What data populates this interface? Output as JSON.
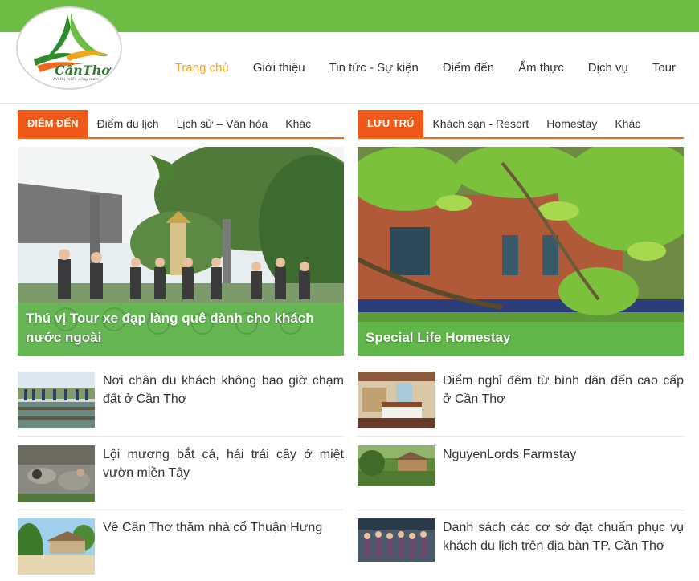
{
  "logo": {
    "text": "CầnThơ",
    "tagline": "Đô thị miền sông nước"
  },
  "nav": {
    "items": [
      "Trang chủ",
      "Giới thiệu",
      "Tin tức - Sự kiện",
      "Điểm đến",
      "Ẩm thực",
      "Dịch vụ",
      "Tour"
    ],
    "active": "Trang chủ"
  },
  "left": {
    "tab_main": "ĐIỂM ĐẾN",
    "tabs": [
      "Điểm du lịch",
      "Lịch sử – Văn hóa",
      "Khác"
    ],
    "feature_title": "Thú vị Tour xe đạp làng quê dành cho khách nước ngoài",
    "articles": [
      "Nơi chân du khách không bao giờ chạm đất ở Cần Thơ",
      "Lội mương bắt cá, hái trái cây ở miệt vườn miền Tây",
      "Về Cần Thơ thăm nhà cổ Thuận Hưng"
    ]
  },
  "right": {
    "tab_main": "LƯU TRÚ",
    "tabs": [
      "Khách sạn - Resort",
      "Homestay",
      "Khác"
    ],
    "feature_title": "Special Life Homestay",
    "articles": [
      "Điểm nghỉ đêm từ bình dân đến cao cấp ở Cần Thơ",
      "NguyenLords Farmstay",
      "Danh sách các cơ sở đạt chuẩn phục vụ khách du lịch trên địa bàn TP. Cần Thơ"
    ]
  },
  "colors": {
    "topbar": "#6dbd45",
    "accent": "#ef5a1a",
    "nav_active": "#f0a51d",
    "caption_bg": "#62be4e"
  }
}
